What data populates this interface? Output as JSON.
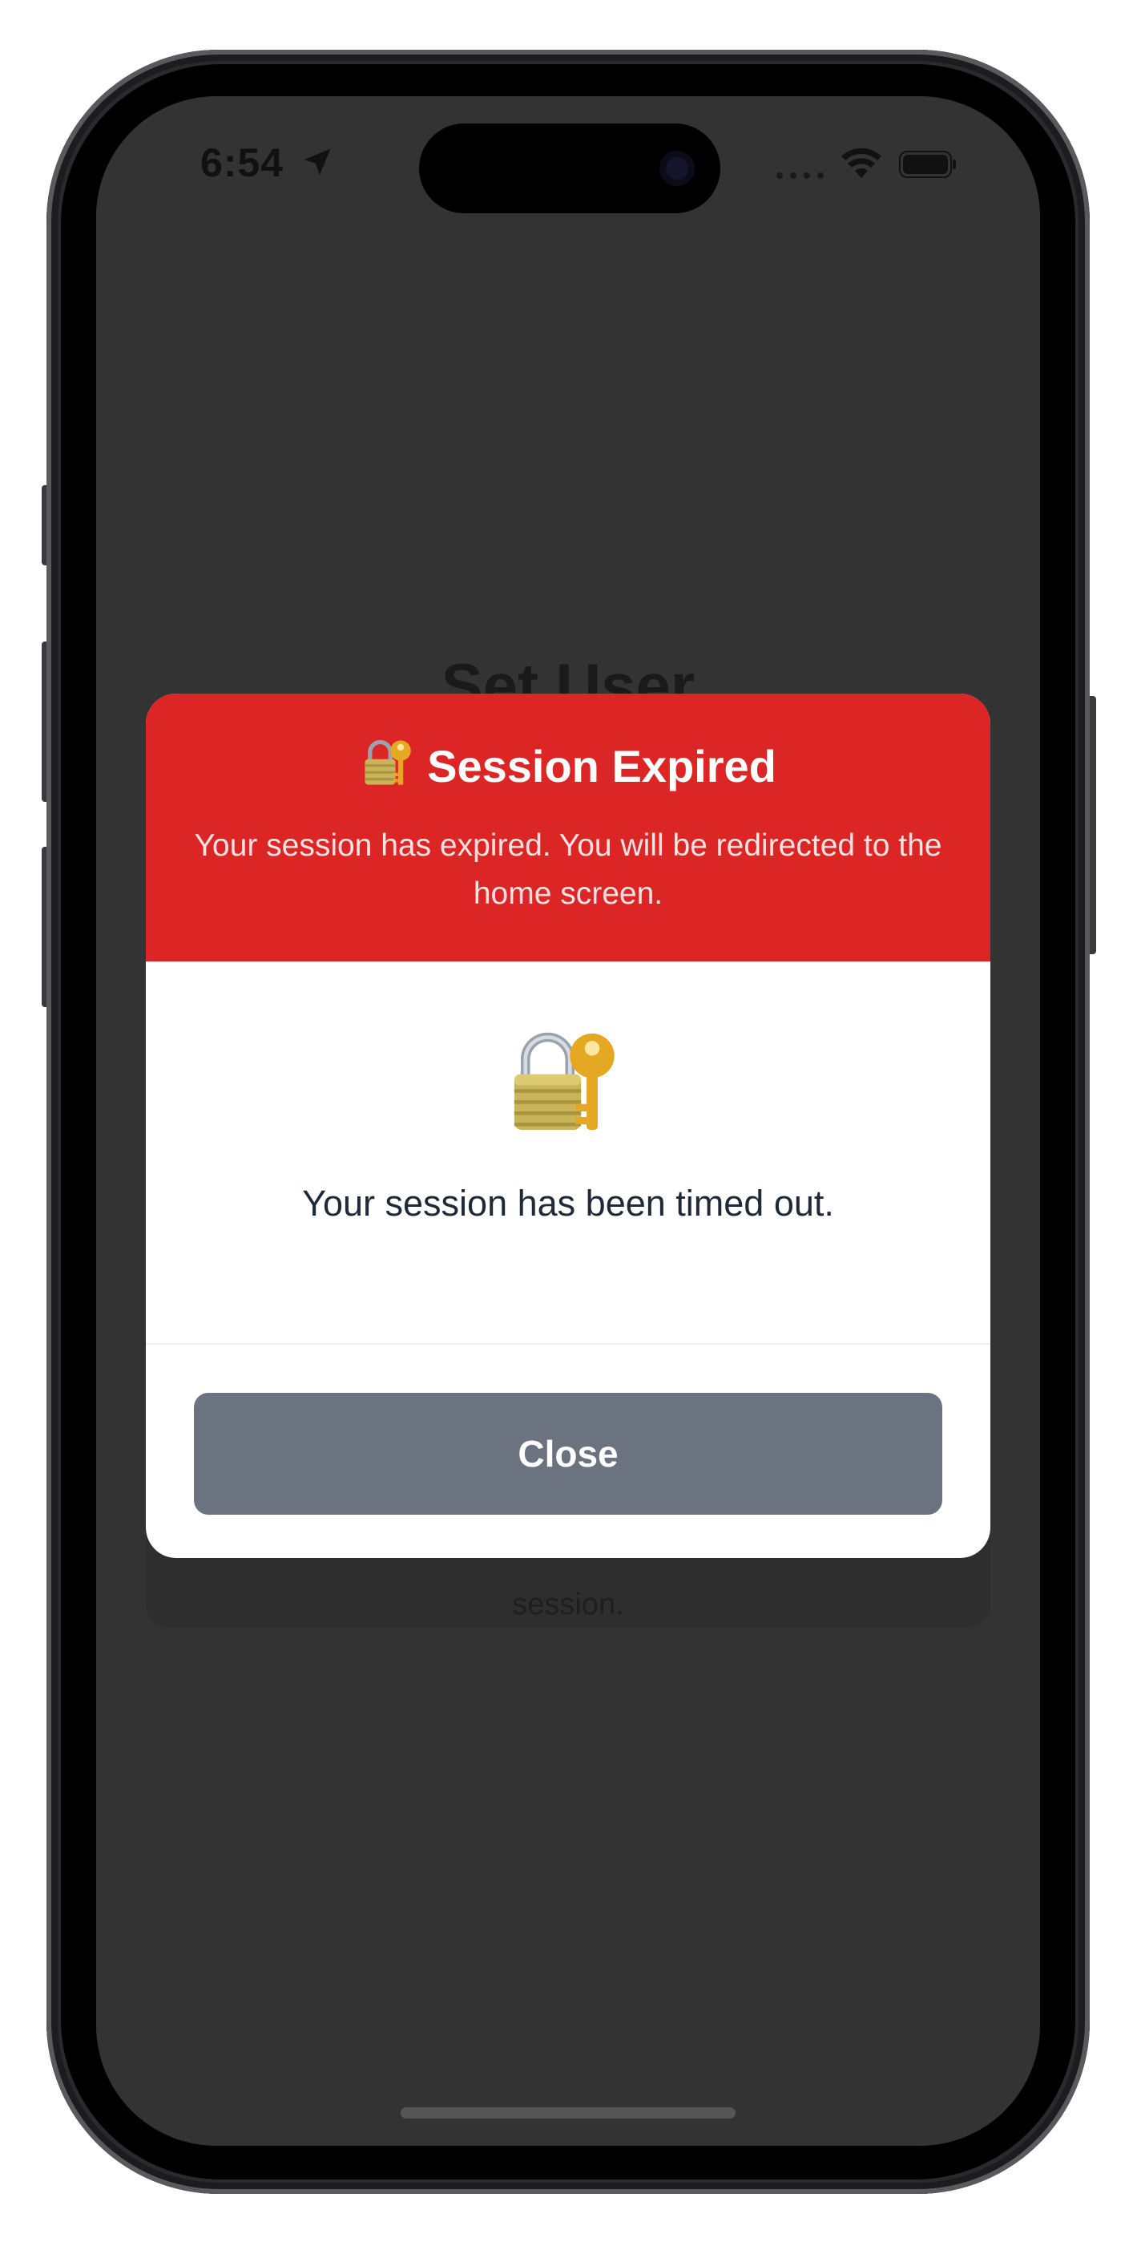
{
  "status_bar": {
    "time": "6:54"
  },
  "background": {
    "title": "Set User",
    "card_text": "session."
  },
  "modal": {
    "title": "Session Expired",
    "subtitle": "Your session has expired. You will be redirected to the home screen.",
    "message": "Your session has been timed out.",
    "close_label": "Close",
    "header_color": "#dc2626",
    "button_color": "#6b7280",
    "icon": "lock-with-key-icon"
  }
}
